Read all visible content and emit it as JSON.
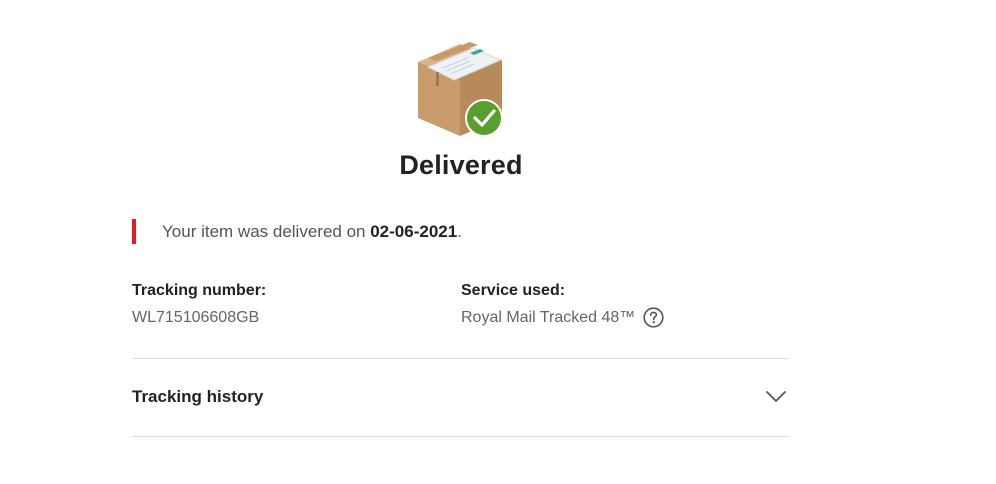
{
  "status": {
    "title": "Delivered",
    "icon": "parcel-delivered-icon",
    "check_color": "#5a9e2f"
  },
  "message": {
    "prefix": "Your item was delivered on ",
    "date": "02-06-2021",
    "suffix": ".",
    "accent_color": "#da202a"
  },
  "details": {
    "tracking_label": "Tracking number:",
    "tracking_number": "WL715106608GB",
    "service_label": "Service used:",
    "service_value": "Royal Mail Tracked 48™",
    "help_icon": "question-circle-icon"
  },
  "history": {
    "label": "Tracking history",
    "icon": "chevron-down-icon"
  }
}
